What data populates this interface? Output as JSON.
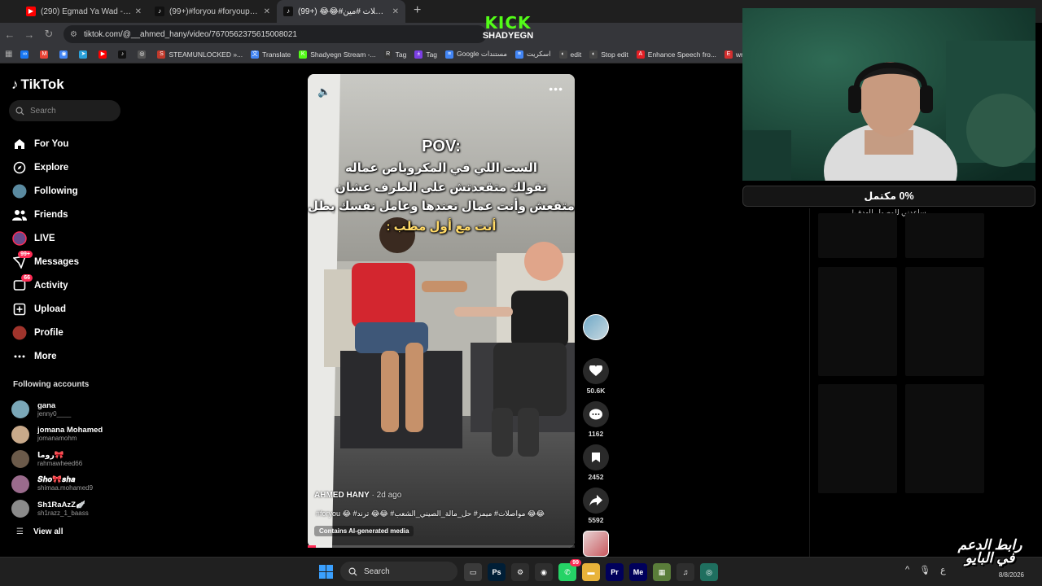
{
  "browser": {
    "tabs": [
      {
        "title": "(290) Egmad Ya Wad - YouTube",
        "color": "#ff0000",
        "glyph": "▶"
      },
      {
        "title": "(99+)#foryou #foryoupage #fy",
        "color": "#111111",
        "glyph": "♪"
      },
      {
        "title": "(99+) 😂😂#مواصلات #مين",
        "color": "#111111",
        "glyph": "♪"
      }
    ],
    "active_tab": 2,
    "url": "tiktok.com/@__ahmed_hany/video/7670562375615008021",
    "bookmarks": [
      {
        "label": "",
        "icon": "meta-icon",
        "color": "#1877f2",
        "glyph": "∞"
      },
      {
        "label": "",
        "icon": "gmail-icon",
        "color": "#ea4335",
        "glyph": "M"
      },
      {
        "label": "",
        "icon": "chrome-icon",
        "color": "#4285f4",
        "glyph": "◉"
      },
      {
        "label": "",
        "icon": "telegram-icon",
        "color": "#2aa1da",
        "glyph": "➤"
      },
      {
        "label": "",
        "icon": "youtube-icon",
        "color": "#ff0000",
        "glyph": "▶"
      },
      {
        "label": "",
        "icon": "tiktok-icon",
        "color": "#111111",
        "glyph": "♪"
      },
      {
        "label": "",
        "icon": "steam-icon",
        "color": "#555555",
        "glyph": "◎"
      },
      {
        "label": "STEAMUNLOCKED »...",
        "icon": "steamunlocked-icon",
        "color": "#c0392b",
        "glyph": "S"
      },
      {
        "label": "Translate",
        "icon": "translate-icon",
        "color": "#4285f4",
        "glyph": "文"
      },
      {
        "label": "Shadyegn Stream -...",
        "icon": "kick-icon",
        "color": "#53fc18",
        "glyph": "K"
      },
      {
        "label": "Tag",
        "icon": "tag-icon",
        "color": "#333333",
        "glyph": "R"
      },
      {
        "label": "Tag",
        "icon": "tag-icon-2",
        "color": "#7b3fe4",
        "glyph": "±"
      },
      {
        "label": "Google مستندات",
        "icon": "docs-icon",
        "color": "#4285f4",
        "glyph": "≡"
      },
      {
        "label": "اسكريت",
        "icon": "docs-icon-2",
        "color": "#4285f4",
        "glyph": "≡"
      },
      {
        "label": "edit",
        "icon": "edit-icon",
        "color": "#444444",
        "glyph": "◐"
      },
      {
        "label": "Stop edit",
        "icon": "stop-edit-icon",
        "color": "#444444",
        "glyph": "◐"
      },
      {
        "label": "Enhance Speech fro...",
        "icon": "adobe-icon",
        "color": "#e31e24",
        "glyph": "A"
      },
      {
        "label": "write arabic",
        "icon": "write-arabic-icon",
        "color": "#d32f2f",
        "glyph": "E"
      }
    ]
  },
  "overlay": {
    "kick_logo": "KICK",
    "kick_channel": "SHADYEGN"
  },
  "tiktok": {
    "logo": "TikTok",
    "search_placeholder": "Search",
    "nav": [
      {
        "label": "For You",
        "icon": "home-icon",
        "badge": ""
      },
      {
        "label": "Explore",
        "icon": "compass-icon",
        "badge": ""
      },
      {
        "label": "Following",
        "icon": "following-avatar-icon",
        "badge": ""
      },
      {
        "label": "Friends",
        "icon": "friends-icon",
        "badge": ""
      },
      {
        "label": "LIVE",
        "icon": "live-avatar-icon",
        "badge": ""
      },
      {
        "label": "Messages",
        "icon": "messages-icon",
        "badge": "99+"
      },
      {
        "label": "Activity",
        "icon": "activity-icon",
        "badge": "66"
      },
      {
        "label": "Upload",
        "icon": "upload-icon",
        "badge": ""
      },
      {
        "label": "Profile",
        "icon": "profile-avatar-icon",
        "badge": ""
      },
      {
        "label": "More",
        "icon": "more-icon",
        "badge": ""
      }
    ],
    "following_title": "Following accounts",
    "following": [
      {
        "name": "gana",
        "handle": "jenny0____",
        "color": "#7aa7b8"
      },
      {
        "name": "jomana Mohamed",
        "handle": "jomanamohm",
        "color": "#c8a98a"
      },
      {
        "name": "روما🎀",
        "handle": "rahmawheed66",
        "color": "#6b5a4a"
      },
      {
        "name": "𝑺𝒉𝒐🎀𝒔𝒉𝒂",
        "handle": "shimaa.mohamed9",
        "color": "#9a6b8c"
      },
      {
        "name": "Sh1RaAzZ🪽",
        "handle": "sh1razz_1_baass",
        "color": "#8a8a8a"
      }
    ],
    "view_all": "View all"
  },
  "video": {
    "pov": "POV:",
    "caption_lines": [
      "الست اللي في المكروباص عماله",
      "تقولك متقعدتش على الطرف عشان",
      "متقعش وأنت عمال تعندها وعامل نفسك بطل",
      "أنت مع أول مطب :"
    ],
    "author": "AHMED HANY",
    "posted": " · 2d ago",
    "tags": "😂😂 مواصلات# ميمز# حل_مالة_الصيني_الشعب# 😂😂 ترند# 😂 foryou#",
    "ai_label": "Contains AI-generated media",
    "progress": 0.03,
    "likes": "50.6K",
    "comments": "1162",
    "saves": "2452",
    "shares": "5592"
  },
  "stream": {
    "goal_text": "0% مكتمل",
    "goal_sub": "ساعدني للوصول للهدف!",
    "watermark_line1": "رابط الدعم",
    "watermark_line2": "في البايو"
  },
  "taskbar": {
    "search": "Search",
    "apps": [
      {
        "icon": "file-explorer-icon",
        "color": "#3a3a3a",
        "glyph": "▭"
      },
      {
        "icon": "photoshop-icon",
        "color": "#001e36",
        "glyph": "Ps"
      },
      {
        "icon": "settings-app-icon",
        "color": "#2e2e2e",
        "glyph": "⚙"
      },
      {
        "icon": "chrome-taskbar-icon",
        "color": "#2e2e2e",
        "glyph": "◉"
      },
      {
        "icon": "whatsapp-icon",
        "color": "#25d366",
        "glyph": "✆"
      },
      {
        "icon": "folder-icon",
        "color": "#e8b33a",
        "glyph": "▬"
      },
      {
        "icon": "premiere-icon",
        "color": "#00005b",
        "glyph": "Pr"
      },
      {
        "icon": "media-encoder-icon",
        "color": "#00005b",
        "glyph": "Me"
      },
      {
        "icon": "gallery-icon",
        "color": "#5a7d3a",
        "glyph": "▦"
      },
      {
        "icon": "audio-icon",
        "color": "#2e2e2e",
        "glyph": "♫"
      },
      {
        "icon": "obs-icon",
        "color": "#1f6f5f",
        "glyph": "◎"
      }
    ],
    "whatsapp_badge": "99",
    "clock_date": "8/8/2026"
  }
}
